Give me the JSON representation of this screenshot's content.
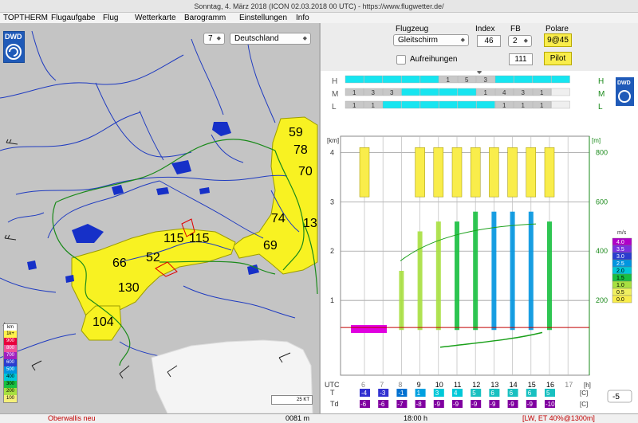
{
  "window": {
    "title": "Sonntag, 4. März 2018 (ICON 02.03.2018 00 UTC) - https://www.flugwetter.de/"
  },
  "menu": [
    "TOPTHERM",
    "Flugaufgabe",
    "Flug",
    "Wetterkarte",
    "Barogramm",
    "Einstellungen",
    "Info"
  ],
  "map": {
    "logo": "DWD",
    "zoom_value": "7",
    "region_value": "Deutschland",
    "scale_label": "25 KT",
    "legend_title": "km",
    "legend": [
      {
        "label": "1k+",
        "color": "#fff24c"
      },
      {
        "label": "900",
        "color": "#e8003c"
      },
      {
        "label": "800",
        "color": "#f0509a"
      },
      {
        "label": "700",
        "color": "#a020c0"
      },
      {
        "label": "600",
        "color": "#2a3ccf"
      },
      {
        "label": "500",
        "color": "#0095e0"
      },
      {
        "label": "400",
        "color": "#00c8d8"
      },
      {
        "label": "300",
        "color": "#18c040"
      },
      {
        "label": "200",
        "color": "#a8e040"
      },
      {
        "label": "100",
        "color": "#f5f07a"
      }
    ],
    "region_values": [
      {
        "text": "59"
      },
      {
        "text": "78"
      },
      {
        "text": "70"
      },
      {
        "text": "74"
      },
      {
        "text": "13"
      },
      {
        "text": "69"
      },
      {
        "text": "115"
      },
      {
        "text": "115"
      },
      {
        "text": "66"
      },
      {
        "text": "52"
      },
      {
        "text": "130"
      },
      {
        "text": "104"
      }
    ]
  },
  "panel": {
    "flugzeug_label": "Flugzeug",
    "flugzeug_value": "Gleitschirm",
    "index_label": "Index",
    "index_value": "46",
    "fb_label": "FB",
    "fb_value": "2",
    "polare_label": "Polare",
    "polare_value": "9@45",
    "aufreihungen_label": "Aufreihungen",
    "extra_value": "111",
    "pilot_label": "Pilot"
  },
  "chart_data": {
    "type": "heatmap",
    "title": "",
    "x_label": "UTC",
    "x_unit": "[h]",
    "x_ticks": [
      6,
      7,
      8,
      9,
      10,
      11,
      12,
      13,
      14,
      15,
      16,
      17
    ],
    "y_left_unit": "[km]",
    "y_left_ticks": [
      1,
      2,
      3,
      4
    ],
    "y_right_ticks": [
      200,
      400,
      600,
      800
    ],
    "y_right_unit": "[m]",
    "cloud_rows": {
      "H": [
        "",
        "",
        "",
        "",
        "",
        "1",
        "5",
        "3",
        "",
        "",
        "",
        ""
      ],
      "M": [
        "1",
        "3",
        "3",
        "",
        "",
        "",
        "",
        "1",
        "4",
        "3",
        "1",
        ""
      ],
      "L": [
        "1",
        "1",
        "",
        "",
        "",
        "",
        "",
        "",
        "1",
        "1",
        "1",
        ""
      ]
    },
    "climb_scale_unit": "m/s",
    "climb_scale": [
      {
        "label": "4.0",
        "color": "#b000c8"
      },
      {
        "label": "3.5",
        "color": "#7a30e0"
      },
      {
        "label": "3.0",
        "color": "#2a3ccf"
      },
      {
        "label": "2.5",
        "color": "#0095e0"
      },
      {
        "label": "2.0",
        "color": "#00c8d8"
      },
      {
        "label": "1.5",
        "color": "#18c040"
      },
      {
        "label": "1.0",
        "color": "#a8e040"
      },
      {
        "label": "0.5",
        "color": "#f0f060"
      },
      {
        "label": "0.0",
        "color": "#f9ed4b"
      }
    ],
    "temperature_label": "T",
    "dewpoint_label": "Td",
    "unit_c": "[C]",
    "T": [
      "-4",
      "-3",
      "-1",
      "1",
      "3",
      "4",
      "5",
      "6",
      "6",
      "6",
      "5"
    ],
    "Td": [
      "-6",
      "-6",
      "-7",
      "-8",
      "-9",
      "-9",
      "-9",
      "-9",
      "-9",
      "-9",
      "-10"
    ],
    "offset_value": "-5"
  },
  "status": {
    "location": "Oberwallis neu",
    "elevation": "0081 m",
    "time": "18:00 h",
    "info": "[LW, ET  40%@1300m]"
  }
}
